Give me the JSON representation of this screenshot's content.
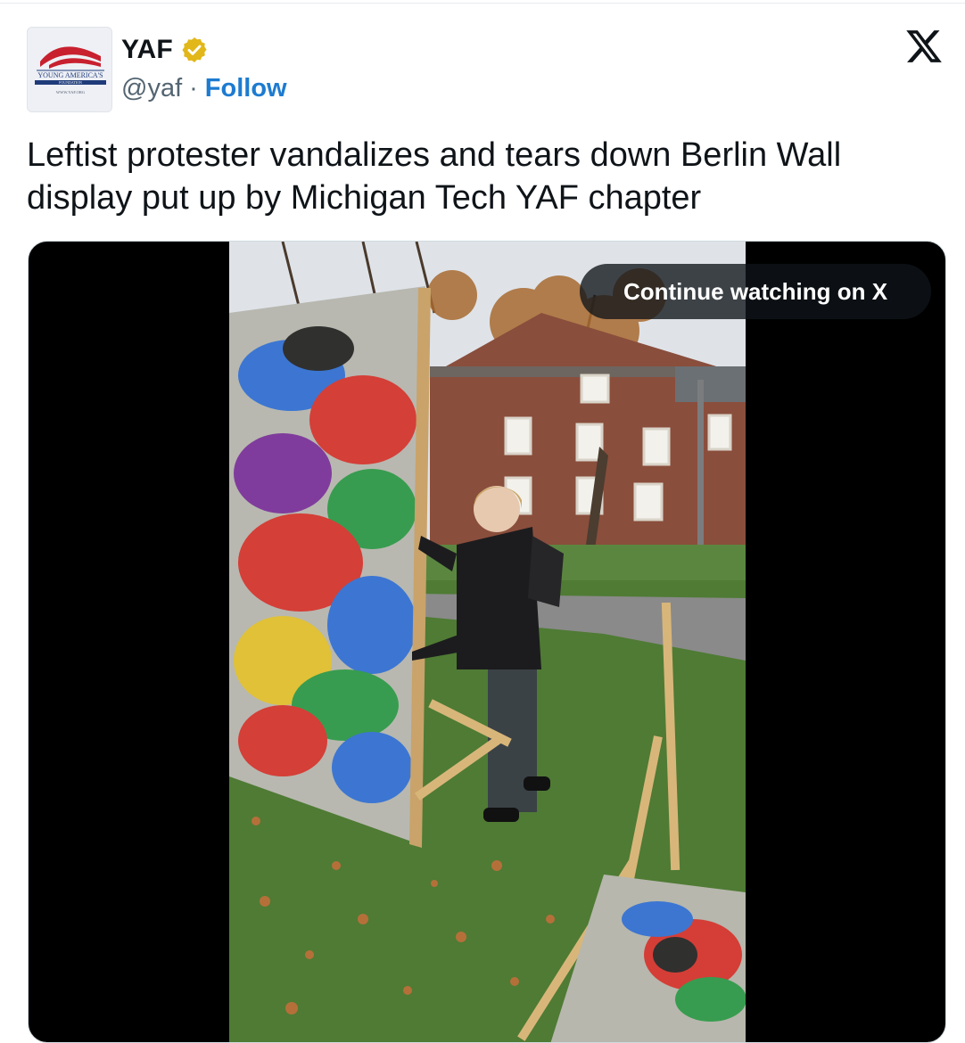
{
  "header": {
    "display_name": "YAF",
    "handle": "@yaf",
    "separator": "·",
    "follow_label": "Follow",
    "avatar_logo_text": "YOUNG AMERICA'S",
    "avatar_logo_subtext": "FOUNDATION",
    "avatar_url_text": "WWW.YAF.ORG"
  },
  "tweet": {
    "text": "Leftist protester vandalizes and tears down Berlin Wall display put up by Michigan Tech YAF chapter"
  },
  "media": {
    "continue_label": "Continue watching on X"
  },
  "colors": {
    "follow": "#1d7bd0",
    "verified_badge": "#e2b719",
    "text_primary": "#0f1419",
    "text_secondary": "#536471"
  },
  "icons": [
    "verified-badge-icon",
    "x-logo-icon"
  ]
}
